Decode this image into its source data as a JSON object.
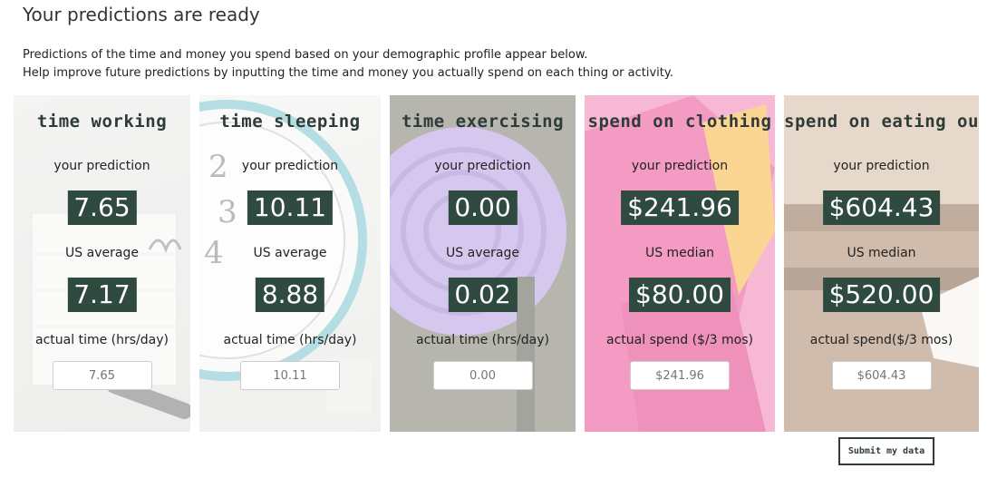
{
  "page": {
    "title": "Your predictions are ready",
    "intro_line1": "Predictions of the time and money you spend based on your demographic profile appear below.",
    "intro_line2": "Help improve future predictions by inputting the time and money you actually spend on each thing or activity."
  },
  "cards": [
    {
      "title": "time working",
      "prediction_label": "your prediction",
      "prediction": "7.65",
      "average_label": "US average",
      "average": "7.17",
      "actual_label": "actual time (hrs/day)",
      "actual_value": "7.65",
      "background_image": "notebook-pen-icon"
    },
    {
      "title": "time sleeping",
      "prediction_label": "your prediction",
      "prediction": "10.11",
      "average_label": "US average",
      "average": "8.88",
      "actual_label": "actual time (hrs/day)",
      "actual_value": "10.11",
      "background_image": "alarm-clock-icon"
    },
    {
      "title": "time exercising",
      "prediction_label": "your prediction",
      "prediction": "0.00",
      "average_label": "US average",
      "average": "0.02",
      "actual_label": "actual time (hrs/day)",
      "actual_value": "0.00",
      "background_image": "yoga-mat-icon"
    },
    {
      "title": "spend on clothing",
      "prediction_label": "your prediction",
      "prediction": "$241.96",
      "average_label": "US median",
      "average": "$80.00",
      "actual_label": "actual spend ($/3 mos)",
      "actual_value": "$241.96",
      "background_image": "shopping-bags-icon"
    },
    {
      "title": "spend on eating out",
      "prediction_label": "your prediction",
      "prediction": "$604.43",
      "average_label": "US median",
      "average": "$520.00",
      "actual_label": "actual spend($/3 mos)",
      "actual_value": "$604.43",
      "background_image": "receipt-table-icon"
    }
  ],
  "submit_label": "Submit my data",
  "colors": {
    "value_box": "#2f4a3f",
    "title_text": "#2f3b38",
    "clothing_accent": "#e8478f",
    "exercise_accent": "#9b7fd0",
    "eating_accent": "#8a6a4c"
  }
}
